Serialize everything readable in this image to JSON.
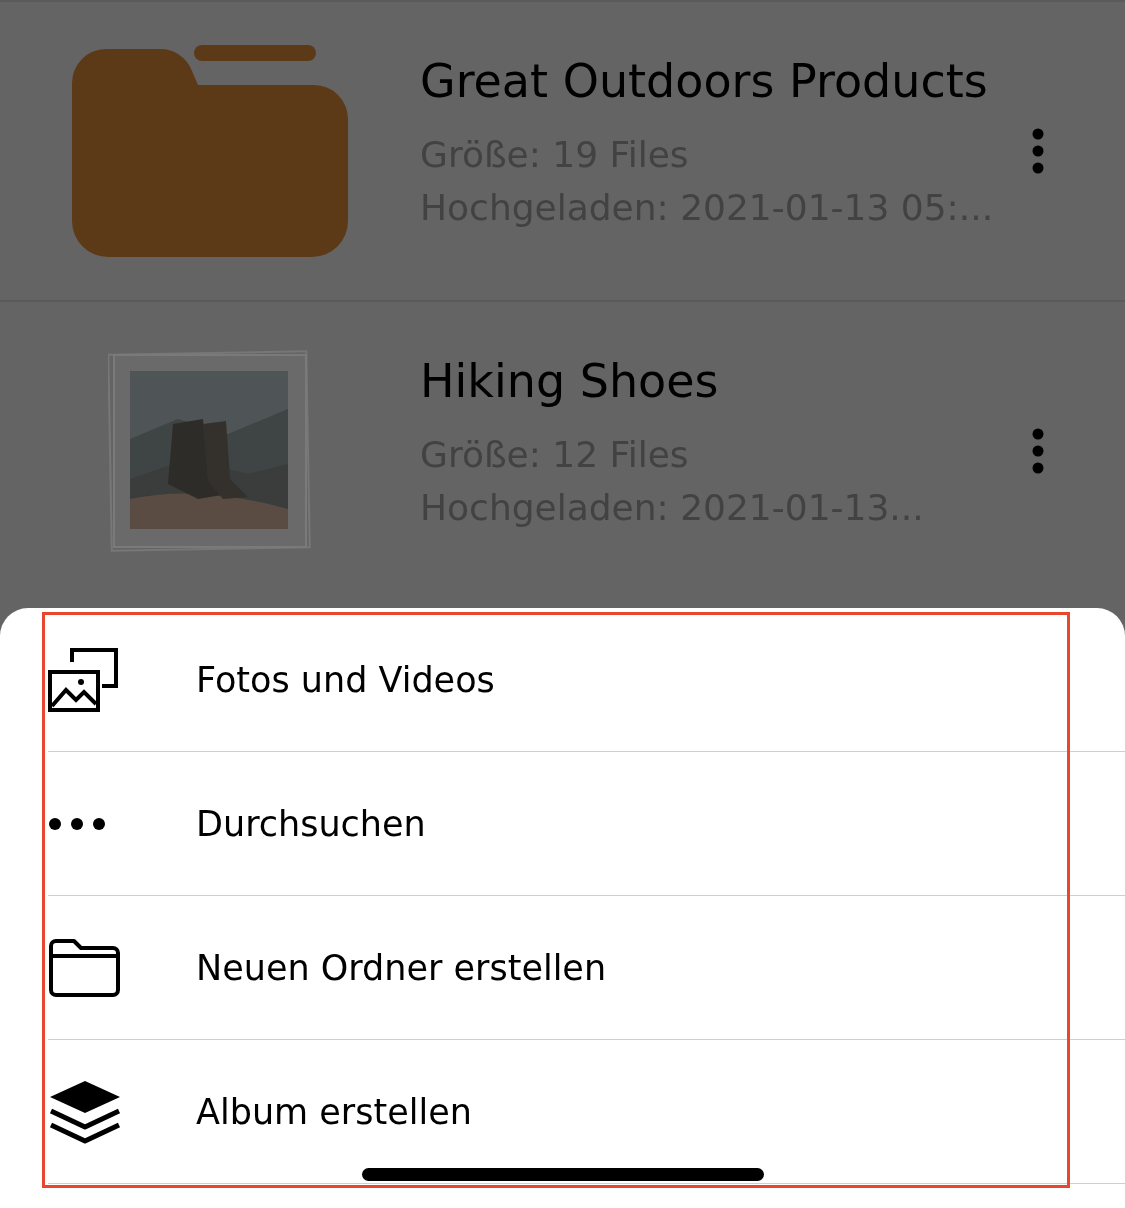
{
  "files": [
    {
      "kind": "folder",
      "title": "Great Outdoors Products",
      "size": "Größe: 19 Files",
      "uploaded": "Hochgeladen: 2021-01-13 05:..."
    },
    {
      "kind": "picture",
      "title": "Hiking Shoes",
      "size": "Größe: 12 Files",
      "uploaded": "Hochgeladen: 2021-01-13..."
    }
  ],
  "sheet": {
    "items": [
      {
        "kind": "media",
        "label": "Fotos und Videos"
      },
      {
        "kind": "more",
        "label": "Durchsuchen"
      },
      {
        "kind": "folder",
        "label": "Neuen Ordner erstellen"
      },
      {
        "kind": "layers",
        "label": "Album erstellen"
      }
    ]
  }
}
